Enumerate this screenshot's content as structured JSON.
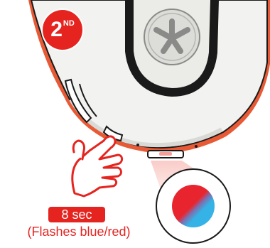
{
  "step": {
    "number": "2",
    "suffix": "ND"
  },
  "duration": "8 sec",
  "caption": "(Flashes blue/red)",
  "colors": {
    "accent": "#e52420",
    "body_fill": "#f2f2f0",
    "outline": "#1a1a1a",
    "led_red": "#e8252e",
    "led_blue": "#35b2e6"
  },
  "icons": {
    "logo": "jlab-logo-icon",
    "hand": "pointing-hand-icon",
    "led": "led-indicator-icon"
  }
}
